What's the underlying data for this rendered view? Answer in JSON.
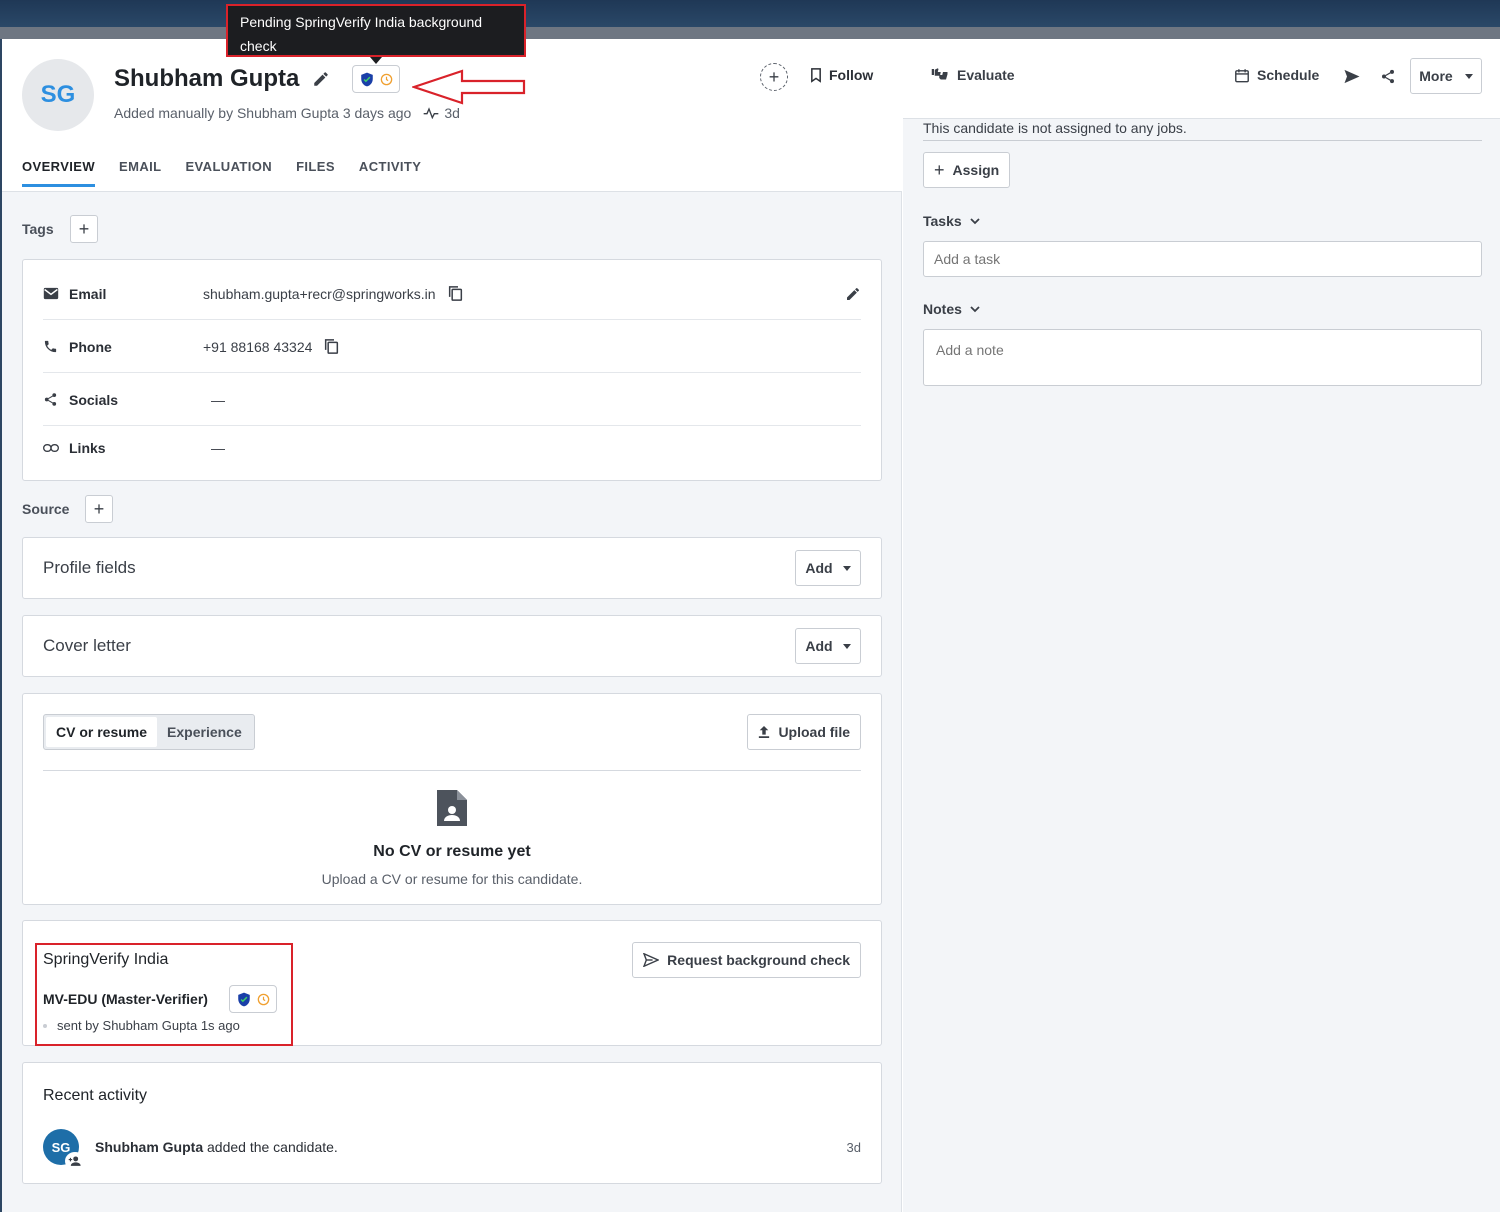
{
  "tooltip": {
    "text": "Pending SpringVerify India background check"
  },
  "candidate": {
    "initials": "SG",
    "name": "Shubham Gupta",
    "added_by": "Added manually by Shubham Gupta 3 days ago",
    "age": "3d",
    "follow_label": "Follow"
  },
  "tabs": [
    "OVERVIEW",
    "EMAIL",
    "EVALUATION",
    "FILES",
    "ACTIVITY"
  ],
  "tags": {
    "label": "Tags"
  },
  "contact": {
    "email": {
      "label": "Email",
      "value": "shubham.gupta+recr@springworks.in"
    },
    "phone": {
      "label": "Phone",
      "value": "+91 88168 43324"
    },
    "socials": {
      "label": "Socials",
      "value": "—"
    },
    "links": {
      "label": "Links",
      "value": "—"
    }
  },
  "source": {
    "label": "Source"
  },
  "profile_fields": {
    "title": "Profile fields",
    "add_label": "Add"
  },
  "cover_letter": {
    "title": "Cover letter",
    "add_label": "Add"
  },
  "resume": {
    "seg_cv": "CV or resume",
    "seg_exp": "Experience",
    "upload_label": "Upload file",
    "empty_title": "No CV or resume yet",
    "empty_sub": "Upload a CV or resume for this candidate."
  },
  "background": {
    "provider": "SpringVerify India",
    "request_label": "Request background check",
    "check_name": "MV-EDU (Master-Verifier)",
    "sent_by": "sent by Shubham Gupta 1s ago"
  },
  "recent": {
    "title": "Recent activity",
    "avatar": "SG",
    "actor": "Shubham Gupta",
    "action": " added the candidate.",
    "time": "3d"
  },
  "right": {
    "evaluate": "Evaluate",
    "schedule": "Schedule",
    "more": "More",
    "not_assigned": "This candidate is not assigned to any jobs.",
    "assign": "Assign",
    "tasks_label": "Tasks",
    "task_placeholder": "Add a task",
    "notes_label": "Notes",
    "note_placeholder": "Add a note"
  },
  "colors": {
    "accent": "#2d8fe0",
    "highlight": "#d9222a",
    "pending": "#f0a030",
    "shield": "#1a3fa8"
  }
}
